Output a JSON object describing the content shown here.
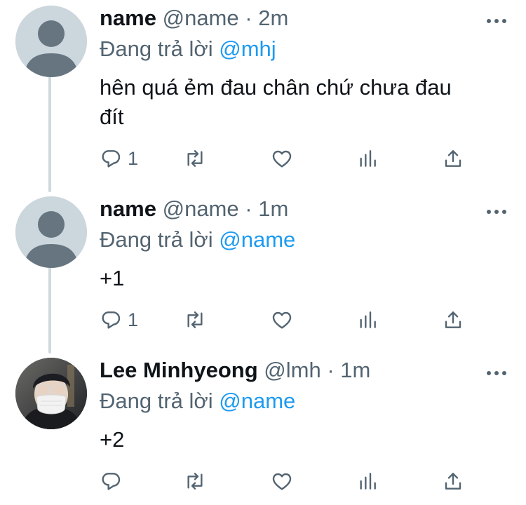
{
  "tweets": [
    {
      "name": "name",
      "handle": "@name",
      "separator": "·",
      "time": "2m",
      "reply_prefix": "Đang trả lời",
      "reply_to": "@mhj",
      "text_line1": "hên quá ẻm đau chân chứ chưa đau",
      "text_line2": "đít",
      "reply_count": "1"
    },
    {
      "name": "name",
      "handle": "@name",
      "separator": "·",
      "time": "1m",
      "reply_prefix": "Đang trả lời",
      "reply_to": "@name",
      "text_line1": "+1",
      "reply_count": "1"
    },
    {
      "name": "Lee Minhyeong",
      "handle": "@lmh",
      "separator": "·",
      "time": "1m",
      "reply_prefix": "Đang trả lời",
      "reply_to": "@name",
      "text_line1": "+2",
      "reply_count": ""
    }
  ],
  "icons": {
    "reply": "reply-icon",
    "retweet": "retweet-icon",
    "like": "heart-icon",
    "views": "analytics-icon",
    "share": "share-icon",
    "more": "more-icon"
  },
  "colors": {
    "mention": "#1d9bf0",
    "secondary_text": "#536471",
    "thread_line": "#cfd9de",
    "default_avatar_bg": "#ccd6dd",
    "default_avatar_fg": "#66757f"
  }
}
